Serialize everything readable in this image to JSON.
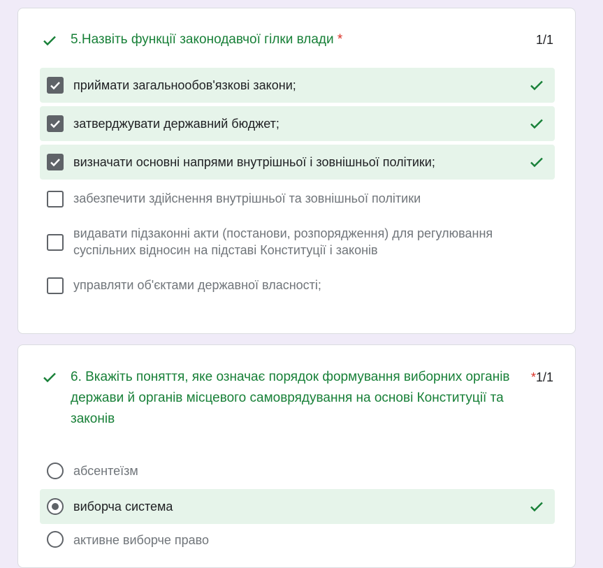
{
  "colors": {
    "background": "#f0ebf8",
    "card": "#ffffff",
    "correct_green": "#188038",
    "correct_bg": "#e6f4ea",
    "required_red": "#d93025"
  },
  "question5": {
    "title": "5.Назвіть функції законодавчої гілки влади",
    "required_mark": "*",
    "score": "1/1",
    "options": [
      {
        "label": "приймати загальнообов'язкові закони;",
        "checked": true,
        "correct": true
      },
      {
        "label": "затверджувати державний бюджет;",
        "checked": true,
        "correct": true
      },
      {
        "label": "визначати основні напрями внутрішньої і зовнішньої політики;",
        "checked": true,
        "correct": true
      },
      {
        "label": "забезпечити здійснення внутрішньої та зовнішньої політики",
        "checked": false,
        "correct": false
      },
      {
        "label": "видавати підзаконні акти (постанови, розпорядження) для регулювання суспільних відносин на підставі Конституції і законів",
        "checked": false,
        "correct": false
      },
      {
        "label": "управляти об'єктами державної власності;",
        "checked": false,
        "correct": false
      }
    ]
  },
  "question6": {
    "title": "6. Вкажіть поняття, яке означає порядок формування виборних органів держави й органів місцевого самоврядування на основі Конституції та законів",
    "required_mark": "*",
    "score": "1/1",
    "options": [
      {
        "label": "абсентеїзм",
        "selected": false,
        "correct": false
      },
      {
        "label": "виборча система",
        "selected": true,
        "correct": true
      },
      {
        "label": "активне виборче право",
        "selected": false,
        "correct": false
      }
    ]
  }
}
